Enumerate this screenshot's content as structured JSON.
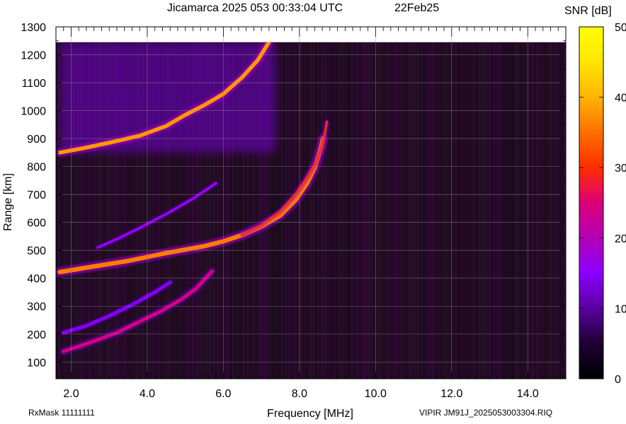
{
  "header": {
    "station": "Jicamarca 2025 053 00:33:04 UTC",
    "date": "22Feb25"
  },
  "footer": {
    "left": "RxMask 11111111",
    "right": "VIPIR  JM91J_2025053003304.RIQ"
  },
  "chart_data": {
    "type": "heatmap",
    "title": "Jicamarca 2025 053 00:33:04 UTC",
    "xlabel": "Frequency [MHz]",
    "ylabel": "Range [km]",
    "xlim": [
      1.6,
      15.0
    ],
    "ylim": [
      40,
      1300
    ],
    "data_top_km": 1245,
    "xticks": [
      2.0,
      4.0,
      6.0,
      8.0,
      10.0,
      12.0,
      14.0
    ],
    "xtick_labels": [
      "2.0",
      "4.0",
      "6.0",
      "8.0",
      "10.0",
      "12.0",
      "14.0"
    ],
    "yticks": [
      100,
      200,
      300,
      400,
      500,
      600,
      700,
      800,
      900,
      1000,
      1100,
      1200,
      1300
    ],
    "ytick_labels": [
      "100",
      "200",
      "300",
      "400",
      "500",
      "600",
      "700",
      "800",
      "900",
      "1000",
      "1100",
      "1200",
      "1300"
    ],
    "grid": true,
    "background_color": "#1a0a1a",
    "colorbar": {
      "label": "SNR [dB]",
      "range": [
        0,
        50
      ],
      "ticks": [
        0,
        10,
        20,
        30,
        40,
        50
      ],
      "tick_labels": [
        "0",
        "10",
        "20",
        "30",
        "40",
        "50"
      ],
      "colors": [
        "#000000",
        "#1e0032",
        "#5a00a0",
        "#8c00ff",
        "#b400b4",
        "#dc0078",
        "#ff2d00",
        "#ff6e00",
        "#ffb400",
        "#ffe600",
        "#ffff00"
      ]
    },
    "traces": [
      {
        "name": "2-hop F echo",
        "snr": 38,
        "width_km": 14,
        "points": [
          [
            1.7,
            850
          ],
          [
            2.3,
            865
          ],
          [
            3.0,
            885
          ],
          [
            3.8,
            910
          ],
          [
            4.5,
            945
          ],
          [
            5.0,
            985
          ],
          [
            5.5,
            1020
          ],
          [
            6.0,
            1060
          ],
          [
            6.5,
            1120
          ],
          [
            6.9,
            1180
          ],
          [
            7.2,
            1245
          ]
        ]
      },
      {
        "name": "O-mode F trace",
        "snr": 36,
        "width_km": 16,
        "points": [
          [
            1.7,
            422
          ],
          [
            2.5,
            440
          ],
          [
            3.5,
            462
          ],
          [
            4.5,
            490
          ],
          [
            5.5,
            515
          ],
          [
            6.0,
            532
          ],
          [
            6.5,
            555
          ],
          [
            7.0,
            585
          ],
          [
            7.5,
            625
          ],
          [
            7.9,
            680
          ],
          [
            8.2,
            740
          ],
          [
            8.4,
            795
          ],
          [
            8.55,
            860
          ],
          [
            8.62,
            900
          ]
        ]
      },
      {
        "name": "X-mode F trace",
        "snr": 30,
        "width_km": 8,
        "points": [
          [
            6.5,
            555
          ],
          [
            7.0,
            590
          ],
          [
            7.5,
            640
          ],
          [
            7.9,
            700
          ],
          [
            8.2,
            760
          ],
          [
            8.45,
            820
          ],
          [
            8.62,
            880
          ],
          [
            8.72,
            960
          ]
        ]
      },
      {
        "name": "sporadic echo high",
        "snr": 16,
        "width_km": 10,
        "points": [
          [
            2.7,
            510
          ],
          [
            3.2,
            540
          ],
          [
            3.8,
            580
          ],
          [
            4.5,
            630
          ],
          [
            5.2,
            685
          ],
          [
            5.8,
            740
          ]
        ]
      },
      {
        "name": "sporadic echo low",
        "snr": 25,
        "width_km": 12,
        "points": [
          [
            1.8,
            138
          ],
          [
            2.5,
            170
          ],
          [
            3.2,
            205
          ],
          [
            3.8,
            245
          ],
          [
            4.4,
            285
          ],
          [
            4.9,
            325
          ],
          [
            5.3,
            365
          ],
          [
            5.7,
            425
          ]
        ]
      },
      {
        "name": "faint diffuse echo",
        "snr": 14,
        "width_km": 14,
        "points": [
          [
            1.8,
            205
          ],
          [
            2.4,
            230
          ],
          [
            3.0,
            265
          ],
          [
            3.6,
            305
          ],
          [
            4.2,
            350
          ],
          [
            4.6,
            385
          ]
        ]
      }
    ],
    "spread_region": {
      "snr": 14,
      "f_range": [
        1.7,
        7.4
      ],
      "range_km": [
        850,
        1245
      ]
    }
  }
}
